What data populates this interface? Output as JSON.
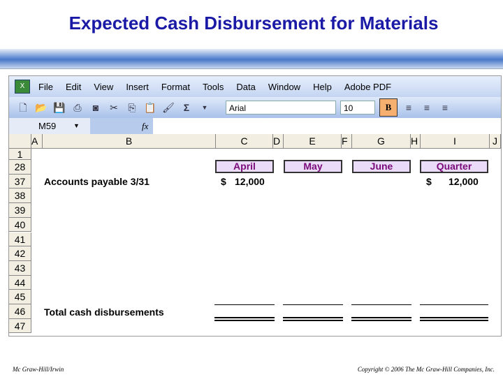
{
  "title": "Expected Cash Disbursement for Materials",
  "menu": [
    "File",
    "Edit",
    "View",
    "Insert",
    "Format",
    "Tools",
    "Data",
    "Window",
    "Help",
    "Adobe PDF"
  ],
  "toolbar": {
    "font": "Arial",
    "size": "10",
    "bold": "B",
    "sum": "Σ"
  },
  "formula_bar": {
    "name_box": "M59",
    "fx": "fx"
  },
  "columns": [
    "A",
    "B",
    "C",
    "D",
    "E",
    "F",
    "G",
    "H",
    "I",
    "J"
  ],
  "rows": [
    "1",
    "28",
    "37",
    "38",
    "39",
    "40",
    "41",
    "42",
    "43",
    "44",
    "45",
    "46",
    "47"
  ],
  "headers": [
    "April",
    "May",
    "June",
    "Quarter"
  ],
  "accounts_payable": {
    "label": "Accounts payable 3/31",
    "april_dollar": "$",
    "april": "12,000",
    "quarter_dollar": "$",
    "quarter": "12,000"
  },
  "total_label": "Total cash disbursements",
  "footer": {
    "left": "Mc Graw-Hill/Irwin",
    "right": "Copyright © 2006 The Mc Graw-Hill Companies, Inc."
  }
}
